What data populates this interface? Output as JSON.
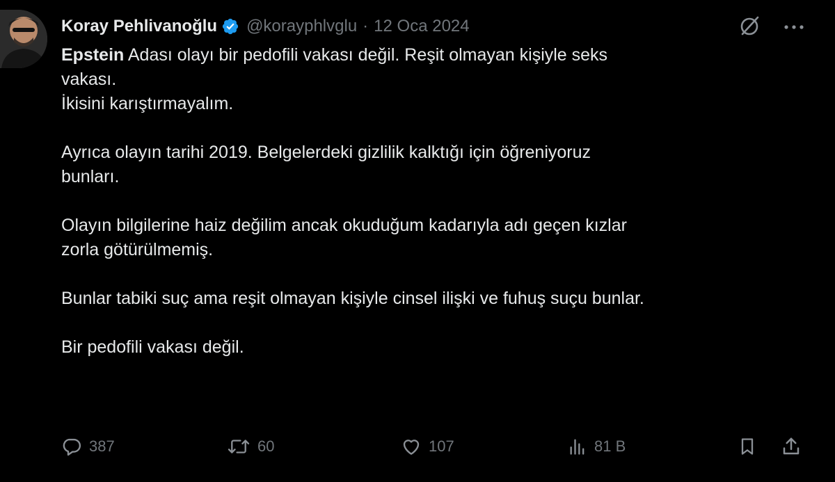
{
  "author": {
    "display_name": "Koray Pehlivanoğlu",
    "handle": "@korayphlvglu",
    "separator": "·",
    "date": "12 Oca 2024",
    "verified": true
  },
  "tweet": {
    "bold_lead": "Epstein",
    "line1_rest": " Adası olayı bir pedofili vakası değil. Reşit olmayan kişiyle seks",
    "line2": "vakası.",
    "line3": "İkisini karıştırmayalım.",
    "para2_line1": "Ayrıca olayın tarihi 2019. Belgelerdeki gizlilik kalktığı için öğreniyoruz",
    "para2_line2": "bunları.",
    "para3_line1": "Olayın bilgilerine haiz değilim ancak okuduğum kadarıyla adı geçen kızlar",
    "para3_line2": "zorla götürülmemiş.",
    "para4": "Bunlar tabiki suç ama reşit olmayan kişiyle cinsel ilişki ve fuhuş suçu bunlar.",
    "para5": "Bir pedofili vakası değil."
  },
  "actions": {
    "replies": "387",
    "retweets": "60",
    "likes": "107",
    "views": "81 B"
  },
  "colors": {
    "background": "#000000",
    "text": "#e7e9ea",
    "muted": "#71767b",
    "verified_blue": "#1d9bf0"
  },
  "icons": [
    "verified-badge-icon",
    "grok-icon",
    "more-icon",
    "reply-icon",
    "retweet-icon",
    "like-icon",
    "views-icon",
    "bookmark-icon",
    "share-icon"
  ]
}
